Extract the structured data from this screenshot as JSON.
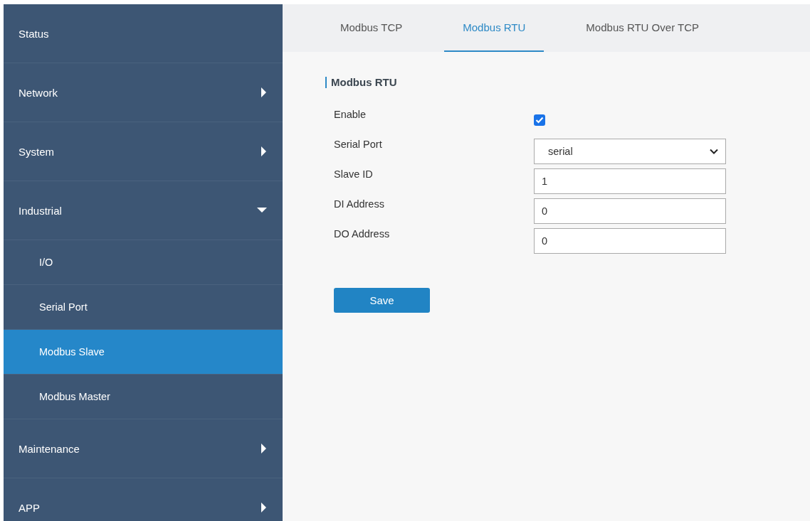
{
  "sidebar": {
    "items": [
      {
        "label": "Status",
        "kind": "link",
        "selected": false
      },
      {
        "label": "Network",
        "kind": "group",
        "expanded": false
      },
      {
        "label": "System",
        "kind": "group",
        "expanded": false
      },
      {
        "label": "Industrial",
        "kind": "group",
        "expanded": true,
        "children": [
          {
            "label": "I/O",
            "selected": false
          },
          {
            "label": "Serial Port",
            "selected": false
          },
          {
            "label": "Modbus Slave",
            "selected": true
          },
          {
            "label": "Modbus Master",
            "selected": false
          }
        ]
      },
      {
        "label": "Maintenance",
        "kind": "group",
        "expanded": false
      },
      {
        "label": "APP",
        "kind": "group",
        "expanded": false
      }
    ]
  },
  "tabs": [
    {
      "label": "Modbus TCP",
      "selected": false
    },
    {
      "label": "Modbus RTU",
      "selected": true
    },
    {
      "label": "Modbus RTU Over TCP",
      "selected": false
    }
  ],
  "section": {
    "title": "Modbus RTU"
  },
  "form": [
    {
      "label": "Enable",
      "kind": "checkbox",
      "checked": true
    },
    {
      "label": "Serial Port",
      "kind": "select",
      "value": "serial"
    },
    {
      "label": "Slave ID",
      "kind": "text",
      "value": "1"
    },
    {
      "label": "DI Address",
      "kind": "text",
      "value": "0"
    },
    {
      "label": "DO Address",
      "kind": "text",
      "value": "0"
    }
  ],
  "buttons": [
    {
      "label": "Save"
    }
  ]
}
